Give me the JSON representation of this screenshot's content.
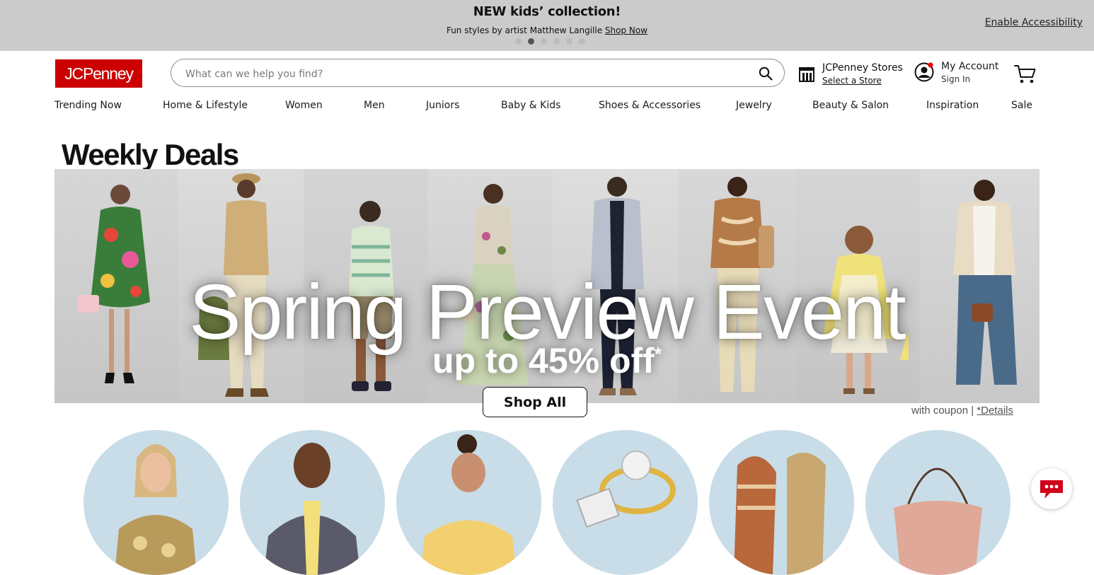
{
  "promo": {
    "title": "NEW kids’ collection!",
    "subtitle": "Fun styles by artist Matthew Langille",
    "link": "Shop Now",
    "slide_count": 6,
    "active_slide": 2
  },
  "accessibility_link": "Enable Accessibility",
  "header": {
    "logo": "JCPenney",
    "search_placeholder": "What can we help you find?",
    "search_value": "",
    "stores_title": "JCPenney Stores",
    "stores_link": "Select a Store",
    "account_title": "My Account",
    "account_sub": "Sign In"
  },
  "nav": [
    "Trending Now",
    "Home & Lifestyle",
    "Women",
    "Men",
    "Juniors",
    "Baby & Kids",
    "Shoes & Accessories",
    "Jewelry",
    "Beauty & Salon",
    "Inspiration",
    "Sale"
  ],
  "hero": {
    "section_title": "Weekly Deals",
    "title": "Spring Preview Event",
    "subtitle": "up to 45% off",
    "subtitle_mark": "*",
    "cta": "Shop All",
    "coupon_text": "with coupon | ",
    "details_link": "*Details"
  },
  "categories": [
    {
      "icon": "woman-portrait-icon"
    },
    {
      "icon": "man-portrait-icon"
    },
    {
      "icon": "girl-portrait-icon"
    },
    {
      "icon": "ring-icon"
    },
    {
      "icon": "sandal-icon"
    },
    {
      "icon": "handbag-icon"
    }
  ],
  "colors": {
    "brand": "#cc0000",
    "promo_bg": "#cbcbcb",
    "circle_bg": "#c8dde8",
    "chat": "#d0021b"
  }
}
